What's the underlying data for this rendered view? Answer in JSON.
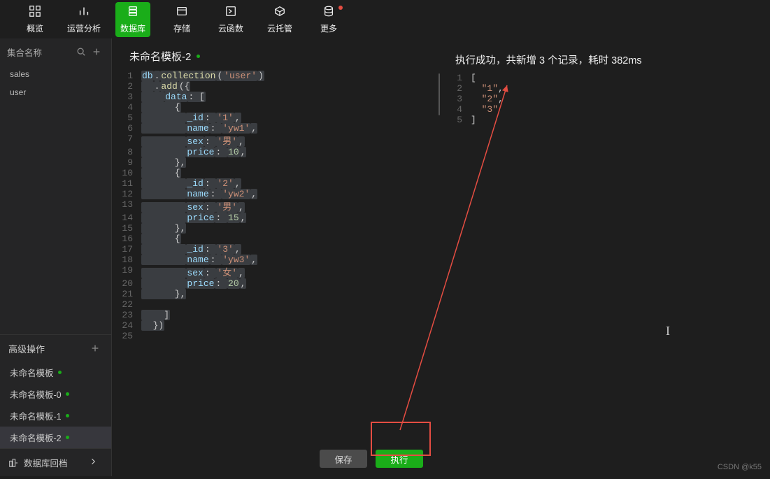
{
  "nav": {
    "items": [
      {
        "label": "概览",
        "icon": "overview"
      },
      {
        "label": "运营分析",
        "icon": "chart"
      },
      {
        "label": "数据库",
        "icon": "database"
      },
      {
        "label": "存储",
        "icon": "storage"
      },
      {
        "label": "云函数",
        "icon": "function"
      },
      {
        "label": "云托管",
        "icon": "hosting"
      },
      {
        "label": "更多",
        "icon": "more"
      }
    ],
    "active_index": 2,
    "red_dot_index": 6
  },
  "sidebar": {
    "collections_label": "集合名称",
    "collections": [
      {
        "name": "sales"
      },
      {
        "name": "user"
      }
    ],
    "advanced_label": "高级操作",
    "templates": [
      {
        "name": "未命名模板"
      },
      {
        "name": "未命名模板-0"
      },
      {
        "name": "未命名模板-1"
      },
      {
        "name": "未命名模板-2"
      }
    ],
    "active_template_index": 3,
    "rollback_label": "数据库回档"
  },
  "editor": {
    "title": "未命名模板-2",
    "buttons": {
      "save": "保存",
      "run": "执行"
    },
    "lines": [
      [
        {
          "t": "db",
          "c": "prop"
        },
        {
          "t": ".",
          "c": "punc"
        },
        {
          "t": "collection",
          "c": "fn"
        },
        {
          "t": "(",
          "c": "punc"
        },
        {
          "t": "'user'",
          "c": "str"
        },
        {
          "t": ")",
          "c": "punc"
        }
      ],
      [
        {
          "t": "  ",
          "c": "punc"
        },
        {
          "t": ".",
          "c": "punc"
        },
        {
          "t": "add",
          "c": "fn"
        },
        {
          "t": "({",
          "c": "punc"
        }
      ],
      [
        {
          "t": "    ",
          "c": "punc"
        },
        {
          "t": "data",
          "c": "prop"
        },
        {
          "t": ": [",
          "c": "punc"
        }
      ],
      [
        {
          "t": "      {",
          "c": "punc"
        }
      ],
      [
        {
          "t": "        ",
          "c": "punc"
        },
        {
          "t": "_id",
          "c": "prop"
        },
        {
          "t": ": ",
          "c": "punc"
        },
        {
          "t": "'1'",
          "c": "str"
        },
        {
          "t": ",",
          "c": "punc"
        }
      ],
      [
        {
          "t": "        ",
          "c": "punc"
        },
        {
          "t": "name",
          "c": "prop"
        },
        {
          "t": ": ",
          "c": "punc"
        },
        {
          "t": "'yw1'",
          "c": "str"
        },
        {
          "t": ",",
          "c": "punc"
        }
      ],
      [
        {
          "t": "        ",
          "c": "punc"
        },
        {
          "t": "sex",
          "c": "prop"
        },
        {
          "t": ": ",
          "c": "punc"
        },
        {
          "t": "'男'",
          "c": "str"
        },
        {
          "t": ",",
          "c": "punc"
        }
      ],
      [
        {
          "t": "        ",
          "c": "punc"
        },
        {
          "t": "price",
          "c": "prop"
        },
        {
          "t": ": ",
          "c": "punc"
        },
        {
          "t": "10",
          "c": "num"
        },
        {
          "t": ",",
          "c": "punc"
        }
      ],
      [
        {
          "t": "      },",
          "c": "punc"
        }
      ],
      [
        {
          "t": "      {",
          "c": "punc"
        }
      ],
      [
        {
          "t": "        ",
          "c": "punc"
        },
        {
          "t": "_id",
          "c": "prop"
        },
        {
          "t": ": ",
          "c": "punc"
        },
        {
          "t": "'2'",
          "c": "str"
        },
        {
          "t": ",",
          "c": "punc"
        }
      ],
      [
        {
          "t": "        ",
          "c": "punc"
        },
        {
          "t": "name",
          "c": "prop"
        },
        {
          "t": ": ",
          "c": "punc"
        },
        {
          "t": "'yw2'",
          "c": "str"
        },
        {
          "t": ",",
          "c": "punc"
        }
      ],
      [
        {
          "t": "        ",
          "c": "punc"
        },
        {
          "t": "sex",
          "c": "prop"
        },
        {
          "t": ": ",
          "c": "punc"
        },
        {
          "t": "'男'",
          "c": "str"
        },
        {
          "t": ",",
          "c": "punc"
        }
      ],
      [
        {
          "t": "        ",
          "c": "punc"
        },
        {
          "t": "price",
          "c": "prop"
        },
        {
          "t": ": ",
          "c": "punc"
        },
        {
          "t": "15",
          "c": "num"
        },
        {
          "t": ",",
          "c": "punc"
        }
      ],
      [
        {
          "t": "      },",
          "c": "punc"
        }
      ],
      [
        {
          "t": "      {",
          "c": "punc"
        }
      ],
      [
        {
          "t": "        ",
          "c": "punc"
        },
        {
          "t": "_id",
          "c": "prop"
        },
        {
          "t": ": ",
          "c": "punc"
        },
        {
          "t": "'3'",
          "c": "str"
        },
        {
          "t": ",",
          "c": "punc"
        }
      ],
      [
        {
          "t": "        ",
          "c": "punc"
        },
        {
          "t": "name",
          "c": "prop"
        },
        {
          "t": ": ",
          "c": "punc"
        },
        {
          "t": "'yw3'",
          "c": "str"
        },
        {
          "t": ",",
          "c": "punc"
        }
      ],
      [
        {
          "t": "        ",
          "c": "punc"
        },
        {
          "t": "sex",
          "c": "prop"
        },
        {
          "t": ": ",
          "c": "punc"
        },
        {
          "t": "'女'",
          "c": "str"
        },
        {
          "t": ",",
          "c": "punc"
        }
      ],
      [
        {
          "t": "        ",
          "c": "punc"
        },
        {
          "t": "price",
          "c": "prop"
        },
        {
          "t": ": ",
          "c": "punc"
        },
        {
          "t": "20",
          "c": "num"
        },
        {
          "t": ",",
          "c": "punc"
        }
      ],
      [
        {
          "t": "      },",
          "c": "punc"
        }
      ],
      [],
      [
        {
          "t": "    ]",
          "c": "punc"
        }
      ],
      [
        {
          "t": "  })",
          "c": "punc"
        }
      ],
      []
    ],
    "highlight_from_line": 1,
    "highlight_to_line": 24
  },
  "result": {
    "status_text": "执行成功，共新增 3 个记录，耗时 382ms",
    "lines": [
      [
        {
          "t": "[",
          "c": "punc"
        }
      ],
      [
        {
          "t": "  ",
          "c": "punc"
        },
        {
          "t": "\"1\"",
          "c": "str"
        },
        {
          "t": ",",
          "c": "punc"
        }
      ],
      [
        {
          "t": "  ",
          "c": "punc"
        },
        {
          "t": "\"2\"",
          "c": "str"
        },
        {
          "t": ",",
          "c": "punc"
        }
      ],
      [
        {
          "t": "  ",
          "c": "punc"
        },
        {
          "t": "\"3\"",
          "c": "str"
        }
      ],
      [
        {
          "t": "]",
          "c": "punc"
        }
      ]
    ]
  },
  "watermark": "CSDN @k55"
}
